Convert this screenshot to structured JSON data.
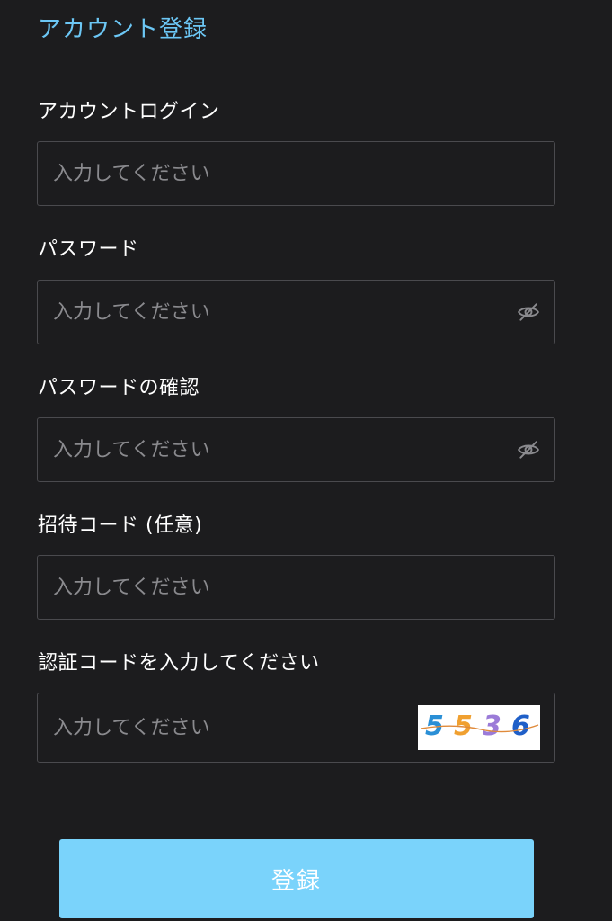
{
  "page": {
    "title": "アカウント登録"
  },
  "form": {
    "account": {
      "label": "アカウントログイン",
      "placeholder": "入力してください",
      "value": ""
    },
    "password": {
      "label": "パスワード",
      "placeholder": "入力してください",
      "value": "",
      "toggle_icon": "eye-slash-icon"
    },
    "password_confirm": {
      "label": "パスワードの確認",
      "placeholder": "入力してください",
      "value": "",
      "toggle_icon": "eye-slash-icon"
    },
    "invite_code": {
      "label": "招待コード (任意)",
      "placeholder": "入力してください",
      "value": ""
    },
    "verification_code": {
      "label": "認証コードを入力してください",
      "placeholder": "入力してください",
      "value": "",
      "captcha": {
        "digits": [
          "5",
          "5",
          "3",
          "6"
        ],
        "colors": [
          "#2a8fd6",
          "#f0a030",
          "#9b7bd8",
          "#1f5fc8"
        ]
      }
    }
  },
  "actions": {
    "submit_label": "登録",
    "submit_color": "#7ad3fb"
  },
  "colors": {
    "background": "#1c1c1e",
    "accent": "#6cc7f5",
    "field_border": "#4a4a4e",
    "placeholder": "#8a8a8e"
  }
}
